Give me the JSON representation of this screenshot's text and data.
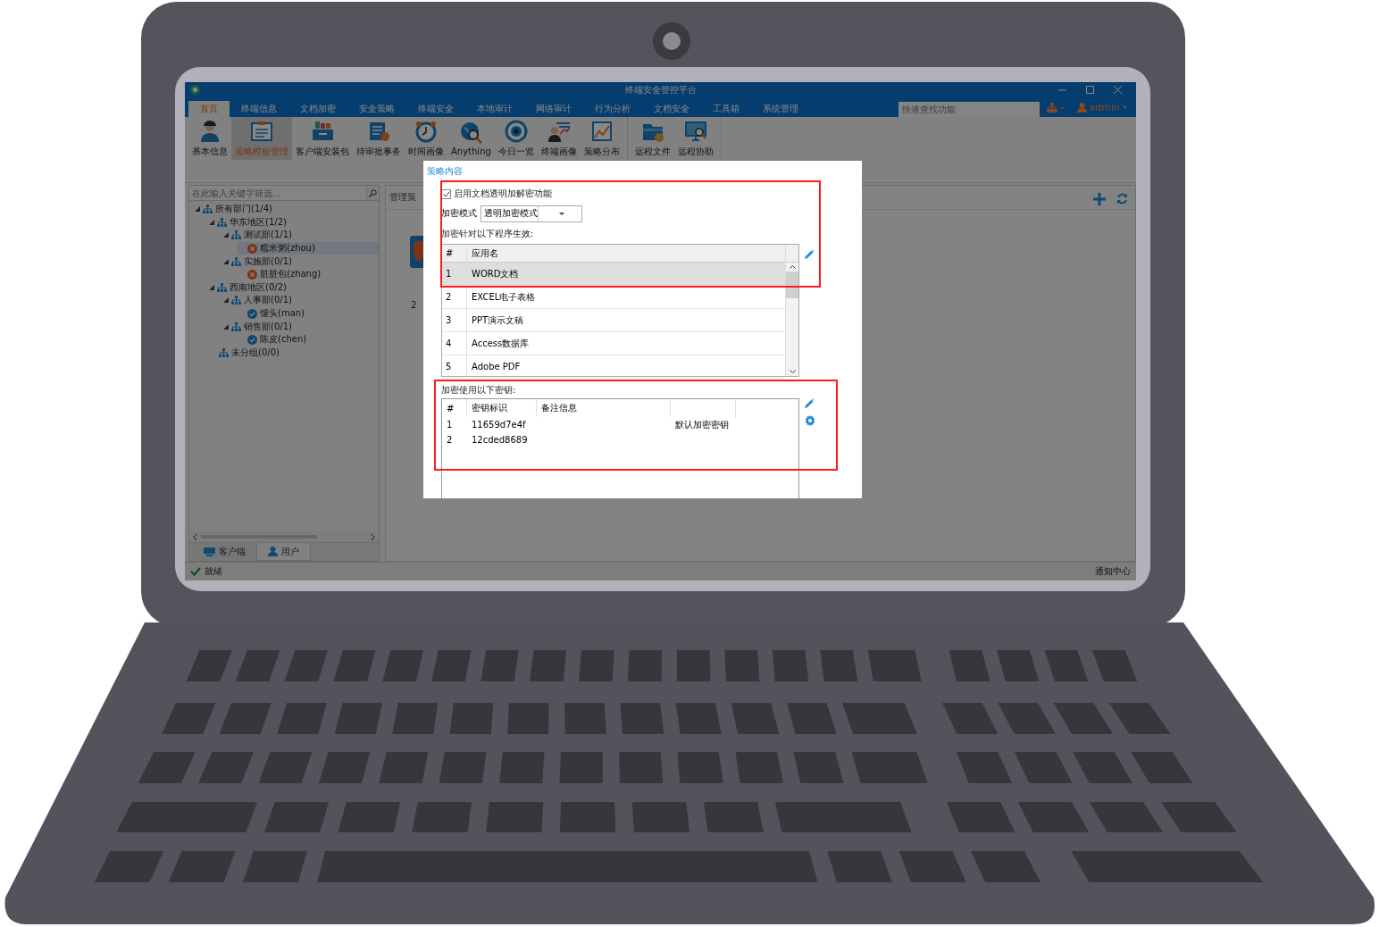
{
  "window": {
    "title": "终端安全管控平台"
  },
  "menu": {
    "tabs": [
      {
        "label": "首页",
        "selected": true
      },
      {
        "label": "终端信息",
        "selected": false
      },
      {
        "label": "文档加密",
        "selected": false
      },
      {
        "label": "安全策略",
        "selected": false
      },
      {
        "label": "终端安全",
        "selected": false
      },
      {
        "label": "本地审计",
        "selected": false
      },
      {
        "label": "网络审计",
        "selected": false
      },
      {
        "label": "行为分析",
        "selected": false
      },
      {
        "label": "文档安全",
        "selected": false
      },
      {
        "label": "工具箱",
        "selected": false
      },
      {
        "label": "系统管理",
        "selected": false
      }
    ],
    "search": {
      "placeholder": "快速查找功能"
    },
    "user": {
      "name": "admin"
    }
  },
  "ribbon": {
    "groups": [
      [
        {
          "label": "基本信息",
          "selected": false
        },
        {
          "label": "策略模板管理",
          "selected": true
        },
        {
          "label": "客户端安装包",
          "selected": false
        },
        {
          "label": "待审批事务",
          "selected": false
        },
        {
          "label": "时间画像",
          "selected": false
        },
        {
          "label": "Anything",
          "selected": false
        },
        {
          "label": "今日一览",
          "selected": false
        },
        {
          "label": "终端画像",
          "selected": false
        },
        {
          "label": "策略分布",
          "selected": false
        }
      ],
      [
        {
          "label": "远程文件",
          "selected": false
        },
        {
          "label": "远程协助",
          "selected": false
        }
      ]
    ]
  },
  "left_panel": {
    "filter": {
      "placeholder": "在此输入关键字筛选..."
    },
    "tree": [
      {
        "kind": "group",
        "label": "所有部门(1/4)",
        "expanded": true,
        "children": [
          {
            "kind": "group",
            "label": "华东地区(1/2)",
            "expanded": true,
            "children": [
              {
                "kind": "group",
                "label": "测试部(1/1)",
                "expanded": true,
                "children": [
                  {
                    "kind": "user",
                    "label": "糯米粥(zhou)",
                    "online": false,
                    "selected": true
                  }
                ]
              },
              {
                "kind": "group",
                "label": "实施部(0/1)",
                "expanded": true,
                "children": [
                  {
                    "kind": "user",
                    "label": "脏脏包(zhang)",
                    "online": false,
                    "selected": false
                  }
                ]
              }
            ]
          },
          {
            "kind": "group",
            "label": "西南地区(0/2)",
            "expanded": true,
            "children": [
              {
                "kind": "group",
                "label": "人事部(0/1)",
                "expanded": true,
                "children": [
                  {
                    "kind": "user",
                    "label": "馒头(man)",
                    "online": true,
                    "selected": false
                  }
                ]
              },
              {
                "kind": "group",
                "label": "销售部(0/1)",
                "expanded": true,
                "children": [
                  {
                    "kind": "user",
                    "label": "陈皮(chen)",
                    "online": true,
                    "selected": false
                  }
                ]
              }
            ]
          },
          {
            "kind": "group",
            "label": "未分组(0/0)"
          }
        ]
      }
    ],
    "tabs": [
      {
        "label": "客户端",
        "selected": false
      },
      {
        "label": "用户",
        "selected": true
      }
    ]
  },
  "right_panel": {
    "header": "管理策",
    "count": "2"
  },
  "status_bar": {
    "text": "就绪",
    "right": "通知中心"
  },
  "dialog": {
    "title": "策略内容",
    "enable": {
      "label": "启用文档透明加解密功能",
      "checked": true
    },
    "mode": {
      "label": "加密模式",
      "value": "透明加密模式"
    },
    "programs_label": "加密针对以下程序生效:",
    "programs": {
      "columns": [
        "#",
        "应用名"
      ],
      "rows": [
        {
          "index": "1",
          "name": "WORD文档",
          "selected": true
        },
        {
          "index": "2",
          "name": "EXCEL电子表格",
          "selected": false
        },
        {
          "index": "3",
          "name": "PPT演示文稿",
          "selected": false
        },
        {
          "index": "4",
          "name": "Access数据库",
          "selected": false
        },
        {
          "index": "5",
          "name": "Adobe PDF",
          "selected": false
        }
      ]
    },
    "keys_label": "加密使用以下密钥:",
    "keys": {
      "columns": [
        "#",
        "密钥标识",
        "备注信息"
      ],
      "rows": [
        {
          "index": "1",
          "id": "11659d7e4f",
          "column_4": "默认加密密钥"
        },
        {
          "index": "2",
          "id": "12cded8689"
        }
      ]
    }
  }
}
